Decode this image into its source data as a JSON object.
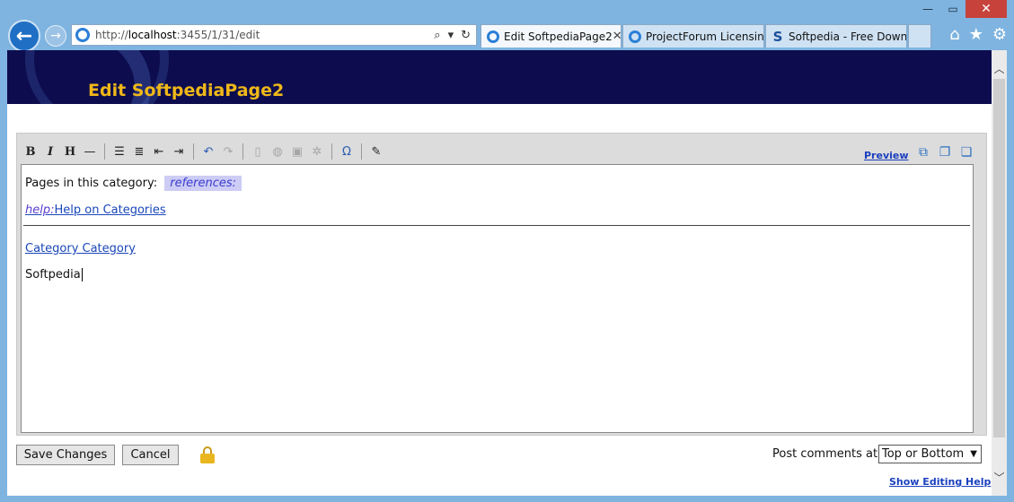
{
  "browser": {
    "address": {
      "prefix": "http://",
      "host": "localhost",
      "rest": ":3455/1/31/edit"
    },
    "tabs": [
      {
        "label": "Edit SoftpediaPage2",
        "icon": "ie-icon",
        "active": true
      },
      {
        "label": "ProjectForum Licensin...",
        "icon": "ie-icon",
        "active": false
      },
      {
        "label": "Softpedia - Free Downl...",
        "icon": "softpedia-icon",
        "active": false
      }
    ],
    "window_controls": {
      "minimize": "—",
      "maximize": "▭",
      "close": "✕"
    },
    "tool_icons": {
      "home": "⌂",
      "favorites": "★",
      "settings": "⚙"
    }
  },
  "page": {
    "title": "Edit SoftpediaPage2",
    "colors": {
      "banner_bg": "#0c0c4e",
      "title": "#f0b818",
      "link": "#1a47b8"
    }
  },
  "editor": {
    "preview_label": "Preview",
    "content": {
      "pages_in_category_label": "Pages in this category:",
      "references_chip": "references:",
      "help_prefix": "help:",
      "help_link": "Help on Categories",
      "category_link": "Category Category",
      "body_text": "Softpedia"
    }
  },
  "footer": {
    "save_label": "Save Changes",
    "cancel_label": "Cancel",
    "post_comments_label": "Post comments at:",
    "post_comments_value": "Top or Bottom",
    "help_link": "Show Editing Help"
  }
}
